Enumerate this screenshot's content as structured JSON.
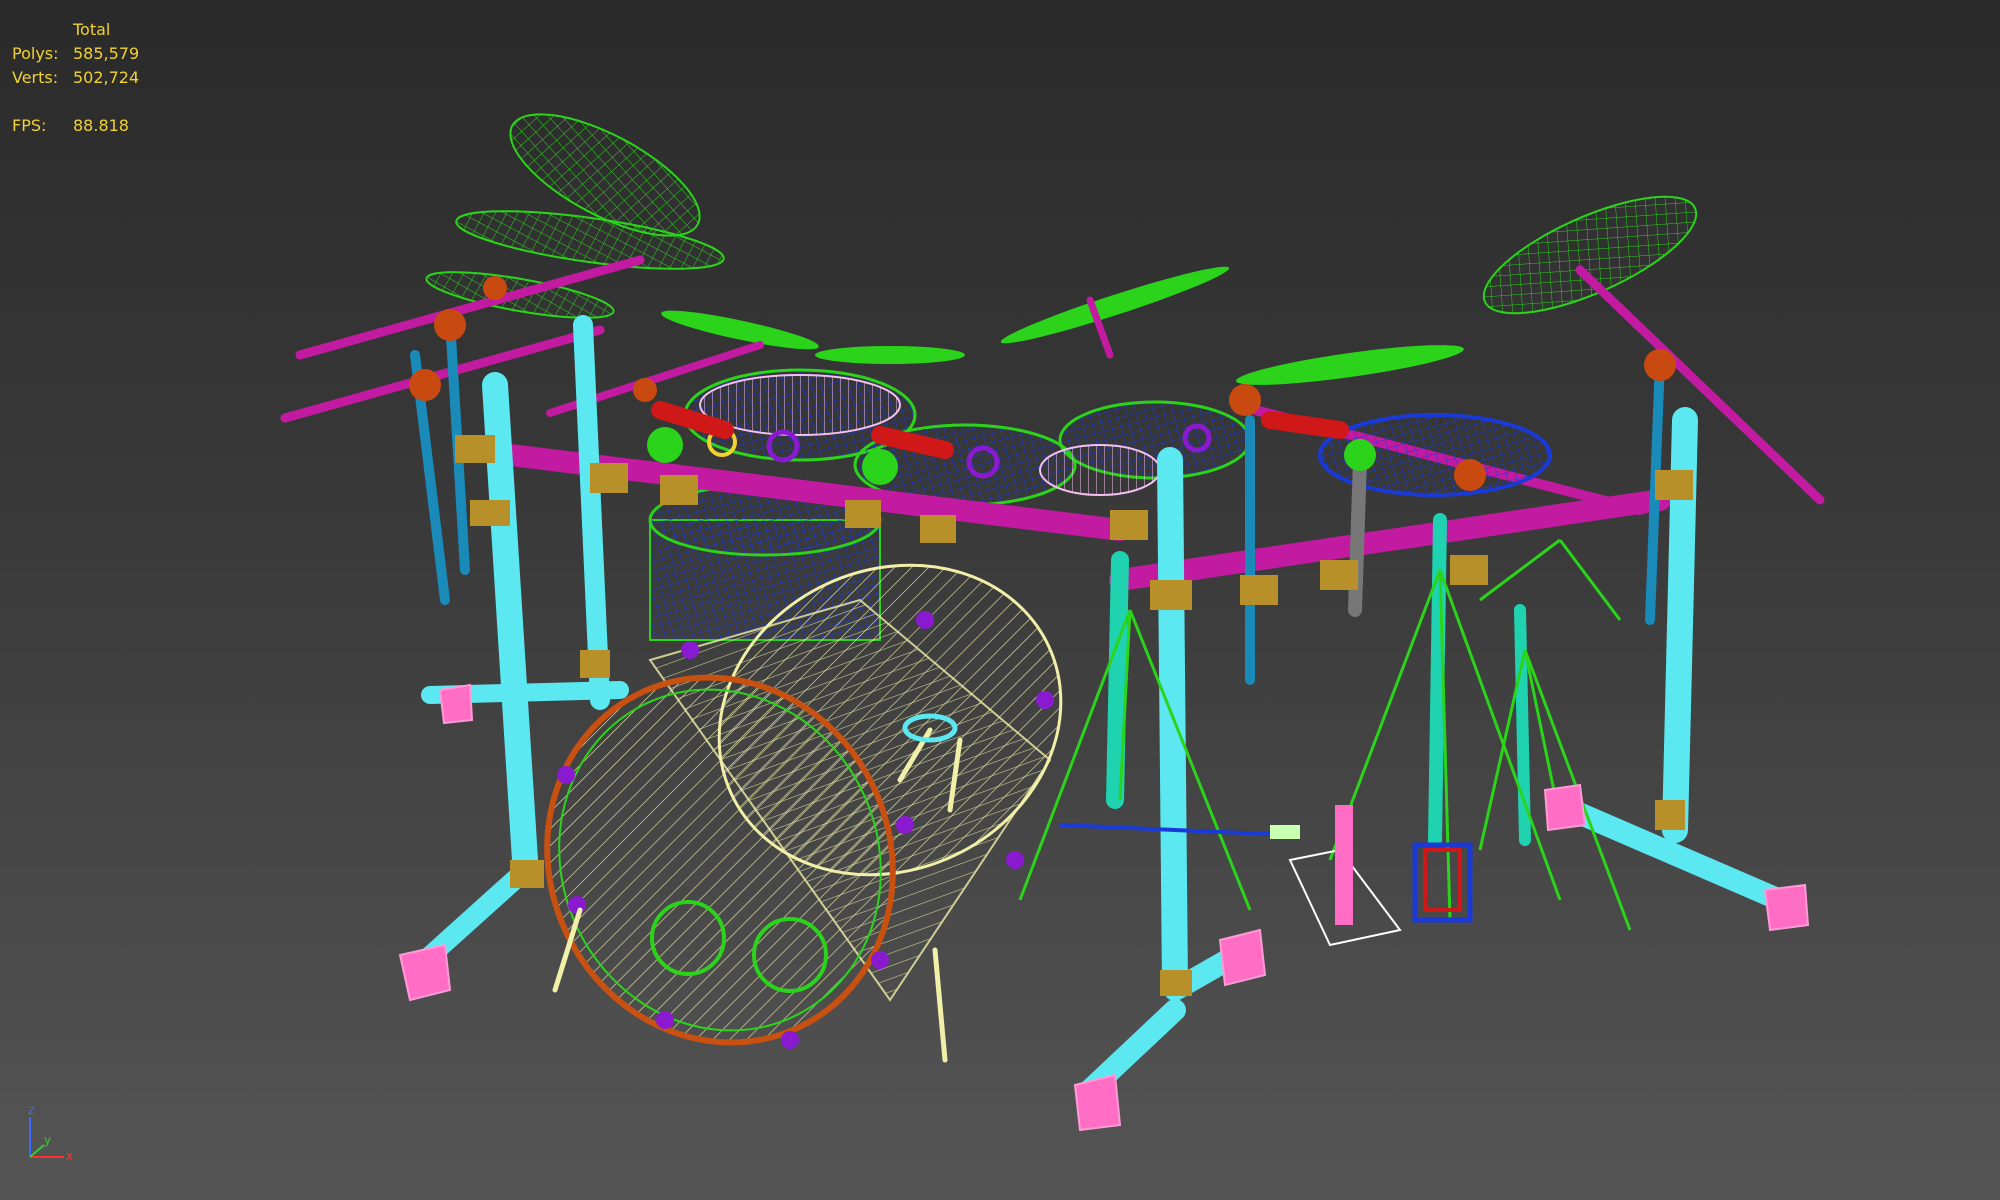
{
  "stats": {
    "header": "Total",
    "polys_label": "Polys:",
    "polys_value": "585,579",
    "verts_label": "Verts:",
    "verts_value": "502,724",
    "fps_label": "FPS:",
    "fps_value": "88.818"
  },
  "axis": {
    "z": "z",
    "y": "y",
    "x": "x"
  },
  "colors": {
    "stats_text": "#f2d230",
    "cymbal": "#2bd41a",
    "stand": "#5ce8f0",
    "rack_bar": "#c21aa0",
    "clamp": "#b8902a",
    "shell": "#f0f0a8",
    "hoop": "#c85010",
    "lug": "#8a1ad0",
    "foot": "#ff6ec4",
    "tom_blue": "#1a3ad8",
    "arm_red": "#d01818"
  }
}
